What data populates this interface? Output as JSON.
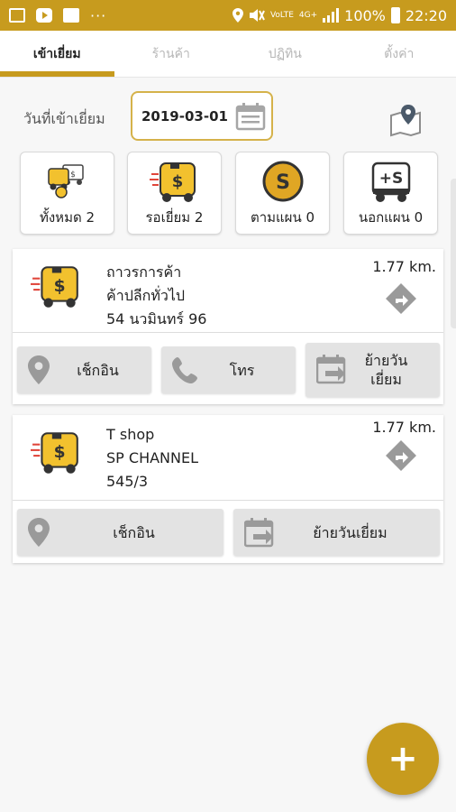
{
  "status_bar": {
    "network_top": "VoLTE",
    "data_type": "4G+",
    "battery": "100%",
    "time": "22:20"
  },
  "tabs": [
    "เข้าเยี่ยม",
    "ร้านค้า",
    "ปฏิทิน",
    "ตั้งค่า"
  ],
  "visit_date": {
    "label": "วันที่เข้าเยี่ยม",
    "value": "2019-03-01"
  },
  "filters": [
    {
      "label": "ทั้งหมด 2",
      "icon": "all-trucks-icon"
    },
    {
      "label": "รอเยี่ยม 2",
      "icon": "pending-truck-icon"
    },
    {
      "label": "ตามแผน 0",
      "icon": "planned-coin-icon"
    },
    {
      "label": "นอกแผน 0",
      "icon": "unplanned-truck-icon"
    }
  ],
  "stores": [
    {
      "name": "ถาวรการค้า",
      "type": "ค้าปลีกทั่วไป",
      "address": "54 นวมินทร์ 96",
      "distance": "1.77 km.",
      "actions": [
        "เช็กอิน",
        "โทร",
        "ย้ายวัน",
        "เยี่ยม"
      ]
    },
    {
      "name": "T shop",
      "type": "SP CHANNEL",
      "address": "545/3",
      "distance": "1.77 km.",
      "actions": [
        "เช็กอิน",
        "ย้ายวันเยี่ยม"
      ]
    }
  ],
  "fab": {
    "label": "+"
  },
  "colors": {
    "accent": "#c79b1e",
    "truck_yellow": "#f2c12e"
  }
}
